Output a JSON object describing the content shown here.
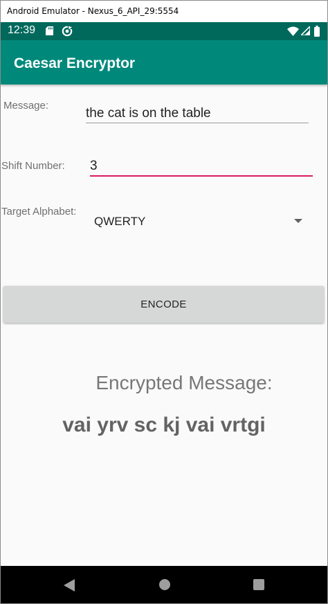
{
  "window": {
    "title": "Android Emulator - Nexus_6_API_29:5554"
  },
  "status_bar": {
    "time": "12:39",
    "icons": [
      "sd-card-icon",
      "sync-icon",
      "wifi-icon",
      "cell-signal-icon",
      "battery-icon"
    ],
    "color": "#00695c"
  },
  "app_bar": {
    "title": "Caesar Encryptor",
    "color": "#00897b"
  },
  "form": {
    "message_label": "Message:",
    "message_value": "the cat is on the table",
    "shift_label": "Shift Number:",
    "shift_value": "3",
    "alphabet_label": "Target Alphabet:",
    "alphabet_selected": "QWERTY",
    "accent_color": "#d81b60"
  },
  "encode_button": {
    "label": "ENCODE"
  },
  "result": {
    "title": "Encrypted Message:",
    "value": "vai yrv sc kj vai vrtgi"
  },
  "nav_bar": {
    "icons": [
      "back-icon",
      "home-icon",
      "recents-icon"
    ]
  }
}
